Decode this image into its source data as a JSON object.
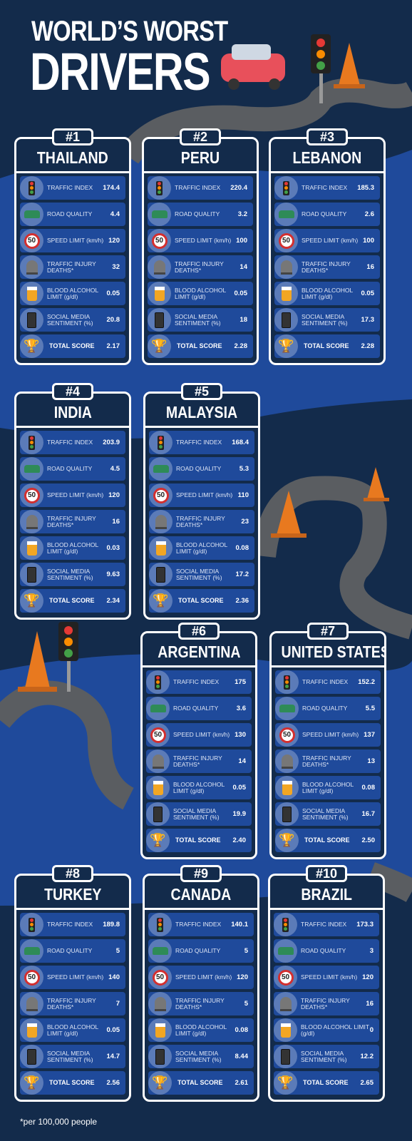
{
  "title": {
    "line1": "WORLD’S WORST",
    "line2": "DRIVERS"
  },
  "labels": {
    "traffic_index": "TRAFFIC INDEX",
    "road_quality": "ROAD QUALITY",
    "speed_limit": "SPEED LIMIT (km/h)",
    "injury_deaths": "TRAFFIC INJURY DEATHS*",
    "blood_alcohol": "BLOOD ALCOHOL LIMIT (g/dl)",
    "social_media": "SOCIAL MEDIA SENTIMENT (%)",
    "total_score": "TOTAL SCORE",
    "speed_sign": "50"
  },
  "countries": [
    {
      "rank": "#1",
      "name": "THAILAND",
      "traffic_index": "174.4",
      "road_quality": "4.4",
      "speed_limit": "120",
      "injury_deaths": "32",
      "blood_alcohol": "0.05",
      "social_media": "20.8",
      "total_score": "2.17"
    },
    {
      "rank": "#2",
      "name": "PERU",
      "traffic_index": "220.4",
      "road_quality": "3.2",
      "speed_limit": "100",
      "injury_deaths": "14",
      "blood_alcohol": "0.05",
      "social_media": "18",
      "total_score": "2.28"
    },
    {
      "rank": "#3",
      "name": "LEBANON",
      "traffic_index": "185.3",
      "road_quality": "2.6",
      "speed_limit": "100",
      "injury_deaths": "16",
      "blood_alcohol": "0.05",
      "social_media": "17.3",
      "total_score": "2.28"
    },
    {
      "rank": "#4",
      "name": "INDIA",
      "traffic_index": "203.9",
      "road_quality": "4.5",
      "speed_limit": "120",
      "injury_deaths": "16",
      "blood_alcohol": "0.03",
      "social_media": "9.63",
      "total_score": "2.34"
    },
    {
      "rank": "#5",
      "name": "MALAYSIA",
      "traffic_index": "168.4",
      "road_quality": "5.3",
      "speed_limit": "110",
      "injury_deaths": "23",
      "blood_alcohol": "0.08",
      "social_media": "17.2",
      "total_score": "2.36"
    },
    {
      "rank": "#6",
      "name": "ARGENTINA",
      "traffic_index": "175",
      "road_quality": "3.6",
      "speed_limit": "130",
      "injury_deaths": "14",
      "blood_alcohol": "0.05",
      "social_media": "19.9",
      "total_score": "2.40"
    },
    {
      "rank": "#7",
      "name": "UNITED STATES",
      "traffic_index": "152.2",
      "road_quality": "5.5",
      "speed_limit": "137",
      "injury_deaths": "13",
      "blood_alcohol": "0.08",
      "social_media": "16.7",
      "total_score": "2.50"
    },
    {
      "rank": "#8",
      "name": "TURKEY",
      "traffic_index": "189.8",
      "road_quality": "5",
      "speed_limit": "140",
      "injury_deaths": "7",
      "blood_alcohol": "0.05",
      "social_media": "14.7",
      "total_score": "2.56"
    },
    {
      "rank": "#9",
      "name": "CANADA",
      "traffic_index": "140.1",
      "road_quality": "5",
      "speed_limit": "120",
      "injury_deaths": "5",
      "blood_alcohol": "0.08",
      "social_media": "8.44",
      "total_score": "2.61"
    },
    {
      "rank": "#10",
      "name": "BRAZIL",
      "traffic_index": "173.3",
      "road_quality": "3",
      "speed_limit": "120",
      "injury_deaths": "16",
      "blood_alcohol": "0",
      "social_media": "12.2",
      "total_score": "2.65"
    }
  ],
  "footnote": "*per 100,000 people",
  "colors": {
    "background": "#132b4b",
    "band": "#1f4a9b",
    "row": "#1f4a9b",
    "road": "#5a5d61",
    "cone": "#e8791f",
    "car": "#e8505b"
  }
}
